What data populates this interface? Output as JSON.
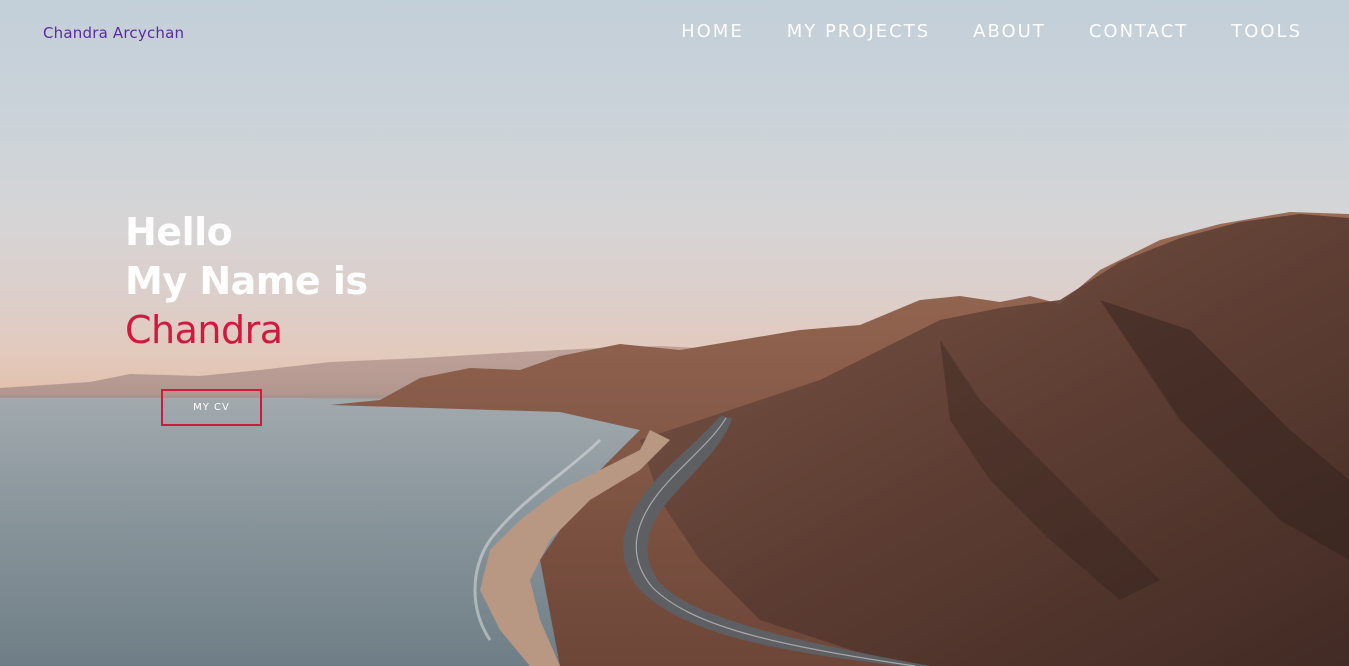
{
  "brand": {
    "name": "Chandra Arcychan"
  },
  "nav": {
    "items": [
      "HOME",
      "MY PROJECTS",
      "ABOUT",
      "CONTACT",
      "TOOLS"
    ]
  },
  "hero": {
    "line1": "Hello",
    "line2": "My Name is",
    "line3": "Chandra",
    "cv_button": "MY CV",
    "background_image": "coastal-mountain-highway-sunset"
  },
  "colors": {
    "accent": "#d1193e",
    "brand": "#5b2ba0",
    "nav_text": "#ffffff"
  }
}
